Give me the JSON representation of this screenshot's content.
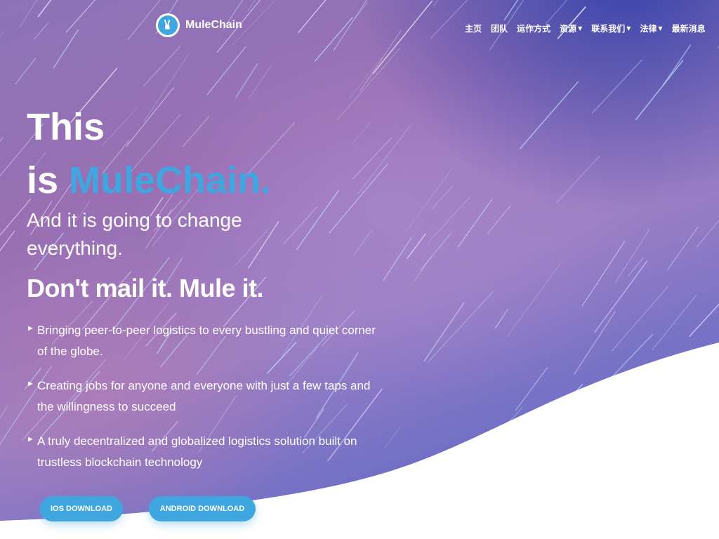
{
  "brand": {
    "name": "MuleChain",
    "logo_icon": "mule-icon",
    "accent": "#3fa6df"
  },
  "nav": {
    "items": [
      {
        "label": "主页",
        "dropdown": false
      },
      {
        "label": "团队",
        "dropdown": false
      },
      {
        "label": "运作方式",
        "dropdown": false
      },
      {
        "label": "资源",
        "dropdown": true
      },
      {
        "label": "联系我们",
        "dropdown": true
      },
      {
        "label": "法律",
        "dropdown": true
      },
      {
        "label": "最新消息",
        "dropdown": false
      }
    ]
  },
  "hero": {
    "line1": "This",
    "line2_prefix": "is ",
    "line2_brand": "MuleChain.",
    "subtitle": "And it is going to change everything.",
    "tagline": "Don't mail it. Mule it.",
    "bullets": [
      "Bringing peer-to-peer logistics to every bustling and quiet corner of the globe.",
      "Creating jobs for anyone and everyone with just a few taps and the willingness to succeed",
      "A truly decentralized and globalized logistics solution built on trustless blockchain technology"
    ]
  },
  "buttons": {
    "ios": "IOS DOWNLOAD",
    "android": "ANDROID DOWNLOAD"
  }
}
